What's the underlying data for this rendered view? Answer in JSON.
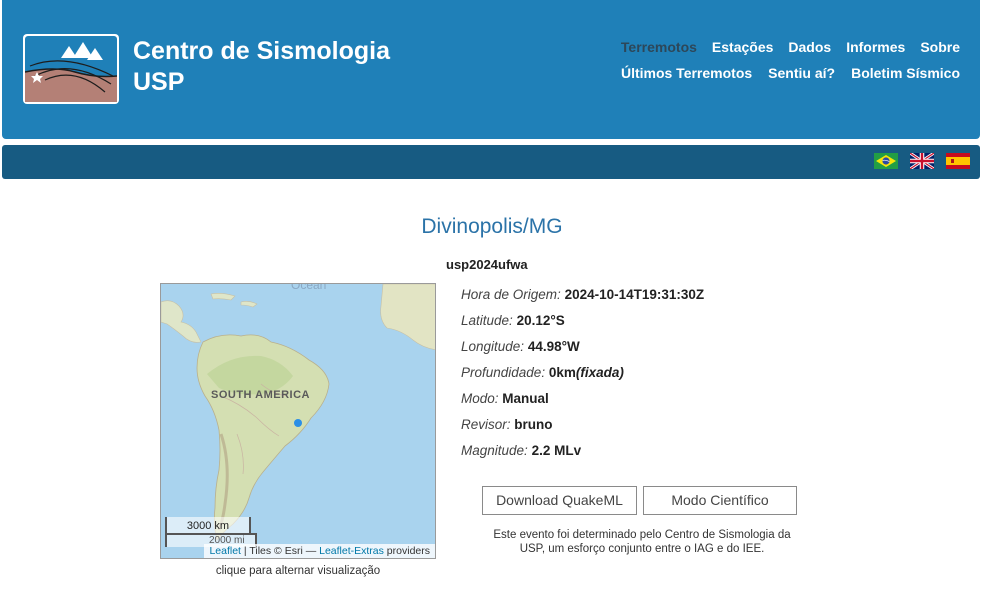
{
  "header": {
    "title_line1": "Centro de Sismologia",
    "title_line2": "USP",
    "nav_primary": [
      "Terremotos",
      "Estações",
      "Dados",
      "Informes",
      "Sobre"
    ],
    "nav_secondary": [
      "Últimos Terremotos",
      "Sentiu aí?",
      "Boletim Sísmico"
    ]
  },
  "colors": {
    "header_bg": "#1f80b8",
    "subbar_bg": "#175b82",
    "title_accent": "#2b73a8",
    "marker": "#2b8fe6"
  },
  "languages": [
    "pt-BR-flag-icon",
    "uk-flag-icon",
    "es-flag-icon"
  ],
  "event": {
    "title": "Divinopolis/MG",
    "id": "usp2024ufwa",
    "fields": [
      {
        "label": "Hora de Origem:",
        "value": "2024-10-14T19:31:30Z"
      },
      {
        "label": "Latitude:",
        "value": "20.12°S"
      },
      {
        "label": "Longitude:",
        "value": "44.98°W"
      },
      {
        "label": "Profundidade:",
        "value": "0km",
        "value_suffix": "(fixada)"
      },
      {
        "label": "Modo:",
        "value": "Manual"
      },
      {
        "label": "Revisor:",
        "value": "bruno"
      },
      {
        "label": "Magnitude:",
        "value": "2.2 MLv"
      }
    ]
  },
  "map": {
    "ocean_label": "Ocean",
    "continent_label": "SOUTH AMERICA",
    "scale_km": "3000 km",
    "scale_mi": "2000 mi",
    "attribution": {
      "leaflet": "Leaflet",
      "tiles": " | Tiles © Esri — ",
      "extras": "Leaflet-Extras",
      "providers": " providers"
    },
    "caption": "clique para alternar visualização"
  },
  "buttons": {
    "quakeml": "Download QuakeML",
    "scientific": "Modo Científico"
  },
  "note": "Este evento foi determinado pelo Centro de Sismologia da USP, um esforço conjunto entre o IAG e do IEE."
}
